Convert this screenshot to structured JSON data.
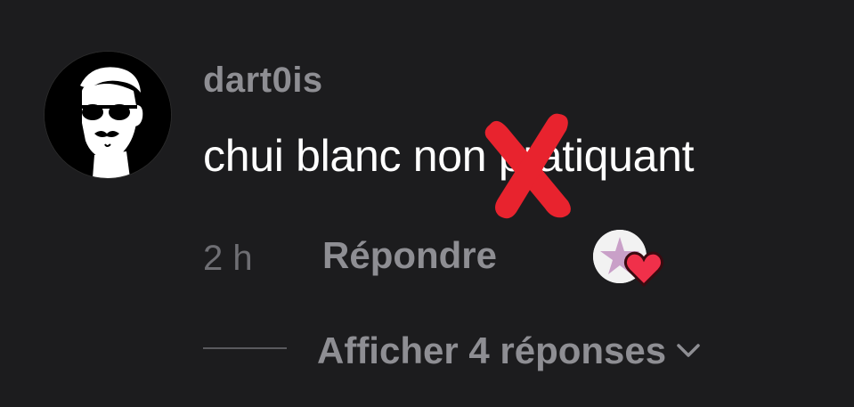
{
  "comment": {
    "username": "dart0is",
    "text_before": "chui blanc ",
    "text_hidden": "non",
    "text_after": " pratiquant",
    "time": "2 h",
    "reply_label": "Répondre",
    "view_replies_label": "Afficher 4 réponses"
  },
  "colors": {
    "background": "#1c1c1e",
    "username": "#8e8e93",
    "text": "#ffffff",
    "redaction": "#e8232e",
    "heart": "#f0304a"
  },
  "icons": {
    "avatar": "sunglasses-mustache-face-avatar",
    "redaction": "red-x-mark-icon",
    "creator_like": "creator-liked-heart-icon",
    "expand": "chevron-down-icon"
  }
}
